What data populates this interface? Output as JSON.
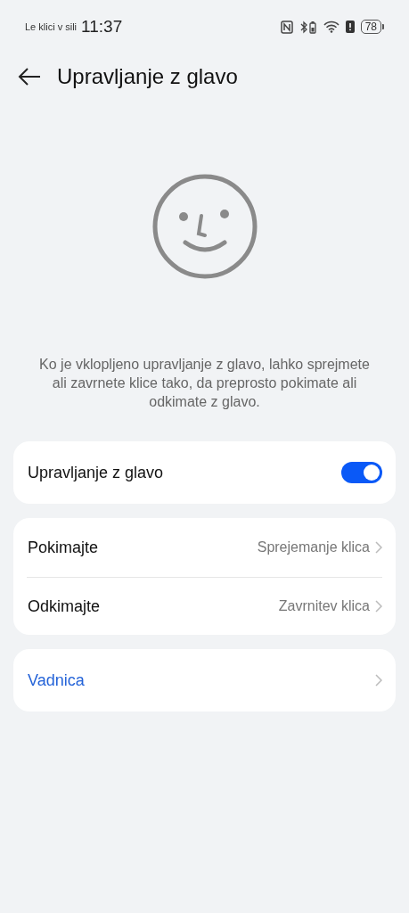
{
  "status_bar": {
    "carrier": "Le klici v sili",
    "time": "11:37",
    "battery": "78"
  },
  "header": {
    "title": "Upravljanje z glavo"
  },
  "description": "Ko je vklopljeno upravljanje z glavo, lahko sprejmete ali zavrnete klice tako, da preprosto pokimate ali odkimate z glavo.",
  "groups": [
    {
      "rows": [
        {
          "kind": "toggle",
          "label": "Upravljanje z glavo",
          "on": true
        }
      ]
    },
    {
      "rows": [
        {
          "kind": "value",
          "label": "Pokimajte",
          "value": "Sprejemanje klica"
        },
        {
          "kind": "value",
          "label": "Odkimajte",
          "value": "Zavrnitev klica"
        }
      ]
    },
    {
      "rows": [
        {
          "kind": "link",
          "label": "Vadnica"
        }
      ]
    }
  ]
}
